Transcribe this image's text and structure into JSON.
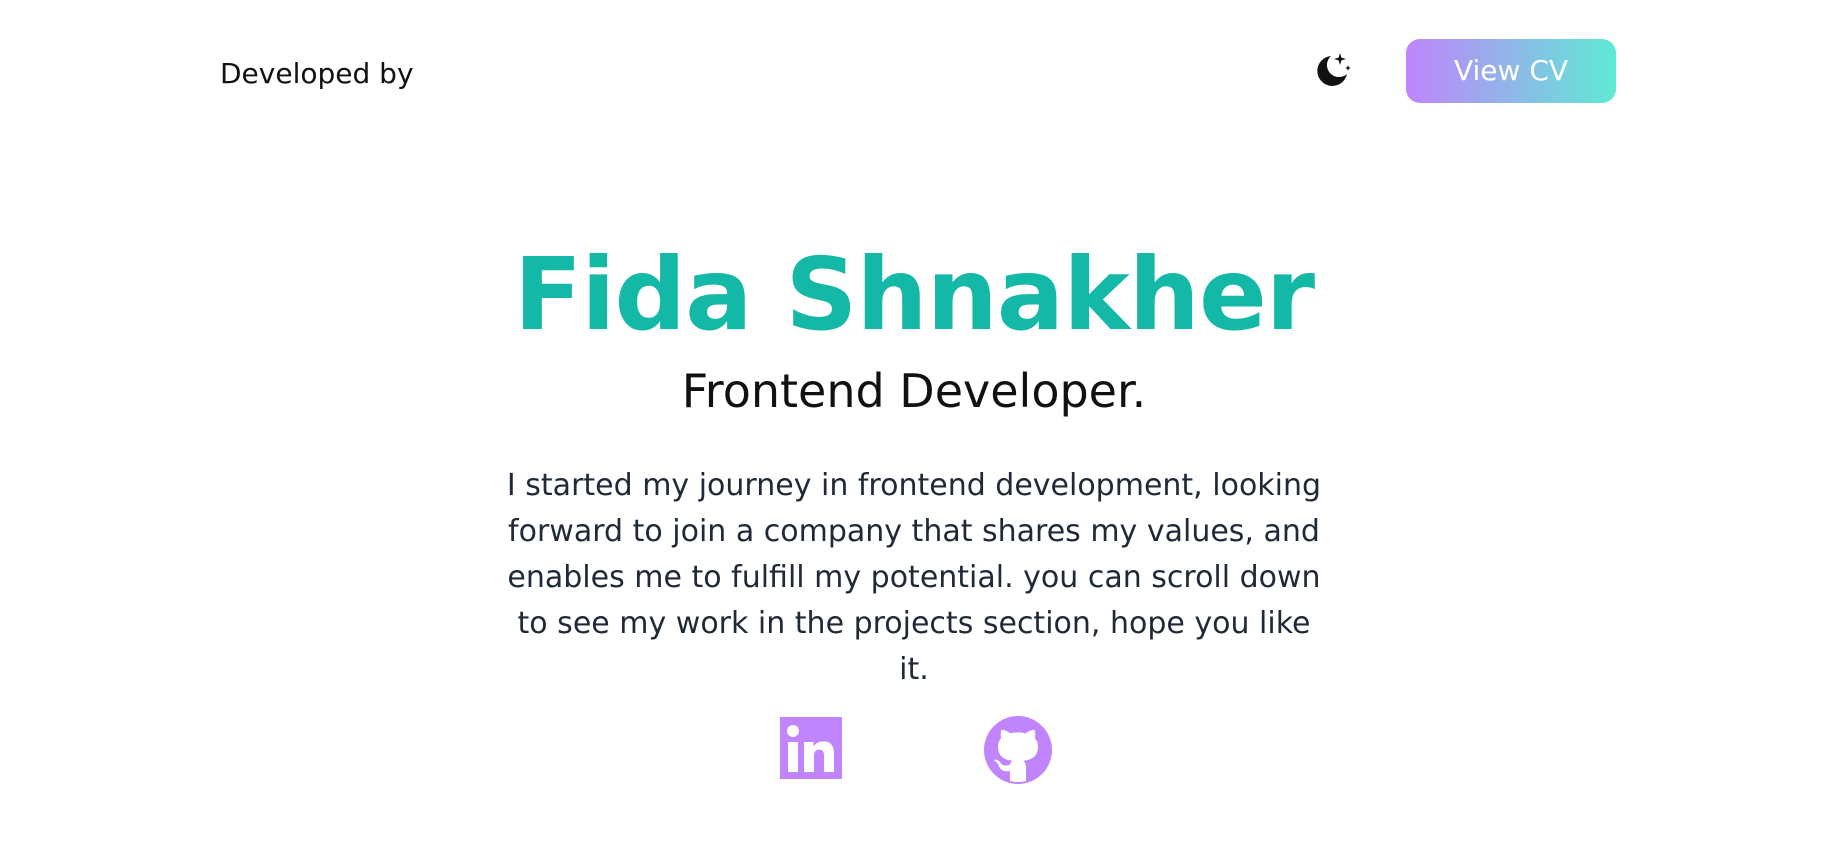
{
  "header": {
    "brand_text": "Developed by",
    "theme_toggle_icon": "moon-stars-icon",
    "cv_button_label": "View CV"
  },
  "hero": {
    "name": "Fida Shnakher",
    "role": "Frontend Developer.",
    "bio": "I started my journey in frontend development, looking forward to join a company that shares my values, and enables me to fulfill my potential. you can scroll down to see my work in the projects section, hope you like it."
  },
  "socials": [
    {
      "icon": "linkedin-icon"
    },
    {
      "icon": "github-icon"
    }
  ],
  "colors": {
    "accent_teal": "#14b8a6",
    "social_purple": "#c084fc",
    "cv_gradient_start": "#c084fc",
    "cv_gradient_end": "#5eead4"
  }
}
